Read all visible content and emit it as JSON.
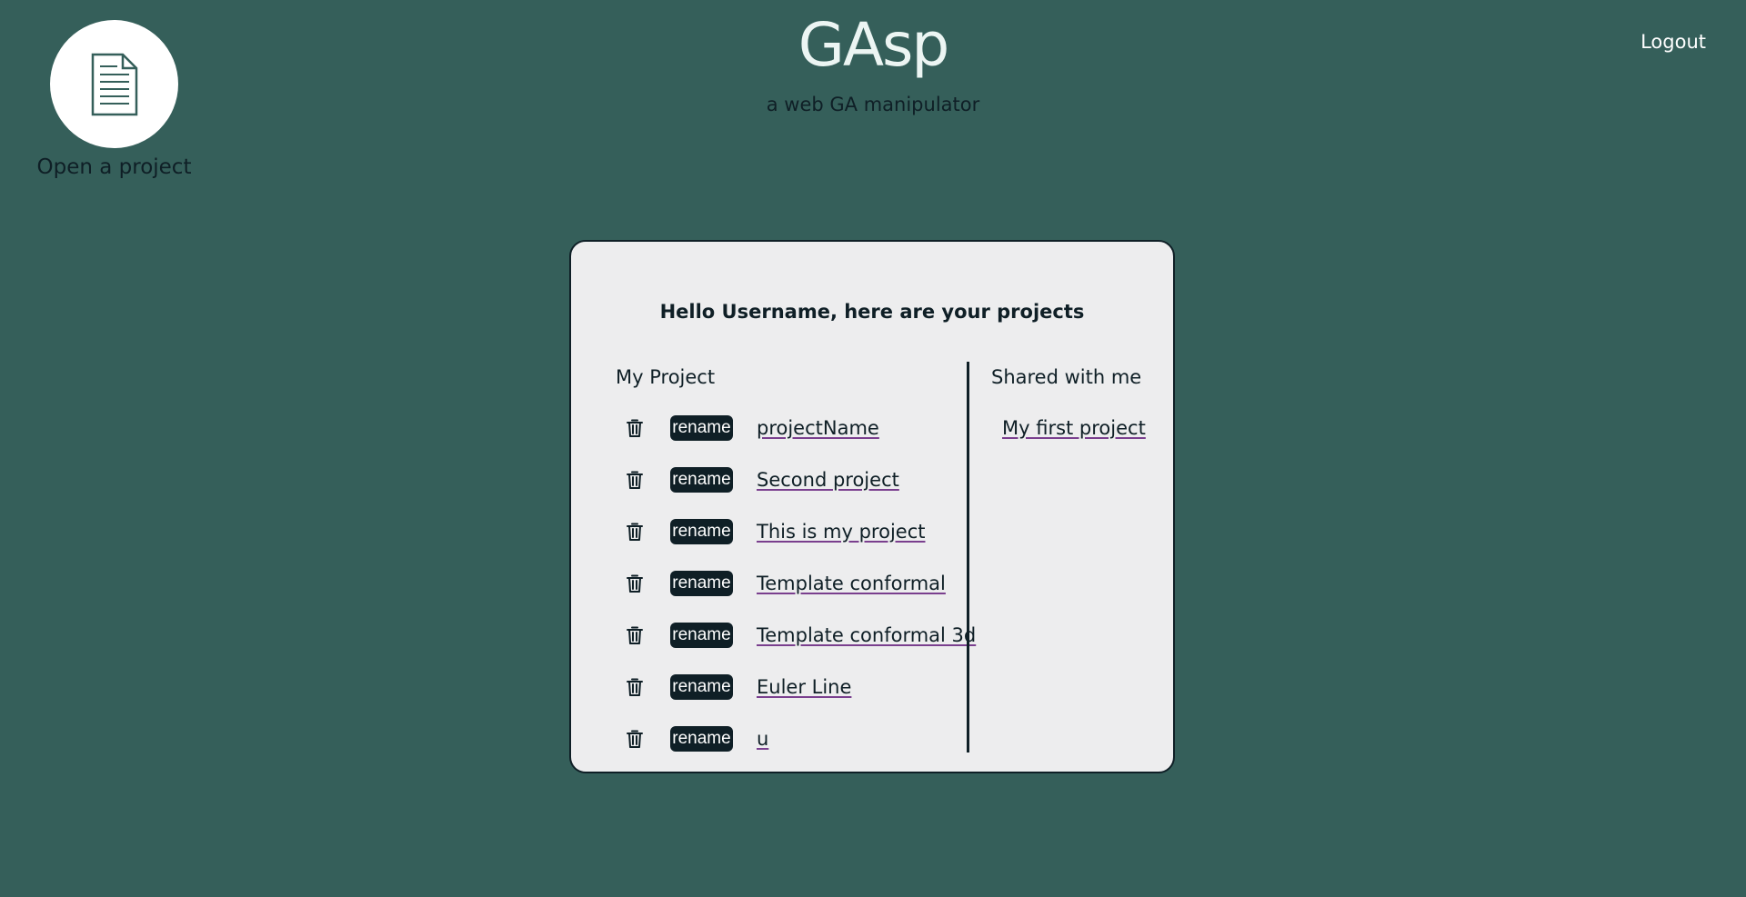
{
  "header": {
    "title": "GAsp",
    "subtitle": "a web GA manipulator",
    "logout_label": "Logout"
  },
  "open_project": {
    "label": "Open a project",
    "icon": "document-icon"
  },
  "panel": {
    "heading": "Hello Username, here are your projects",
    "my_projects": {
      "heading": "My Project",
      "rename_label": "rename",
      "delete_icon": "trash-icon",
      "items": [
        {
          "name": "projectName"
        },
        {
          "name": "Second project"
        },
        {
          "name": "This is my project"
        },
        {
          "name": "Template conformal"
        },
        {
          "name": "Template conformal 3d"
        },
        {
          "name": "Euler Line"
        },
        {
          "name": "u"
        }
      ]
    },
    "shared": {
      "heading": "Shared with me",
      "items": [
        {
          "name": "My first project"
        }
      ]
    }
  },
  "colors": {
    "background": "#355f5a",
    "panel": "#ededee",
    "dark": "#0f1f26",
    "title": "#ecf5f3"
  }
}
